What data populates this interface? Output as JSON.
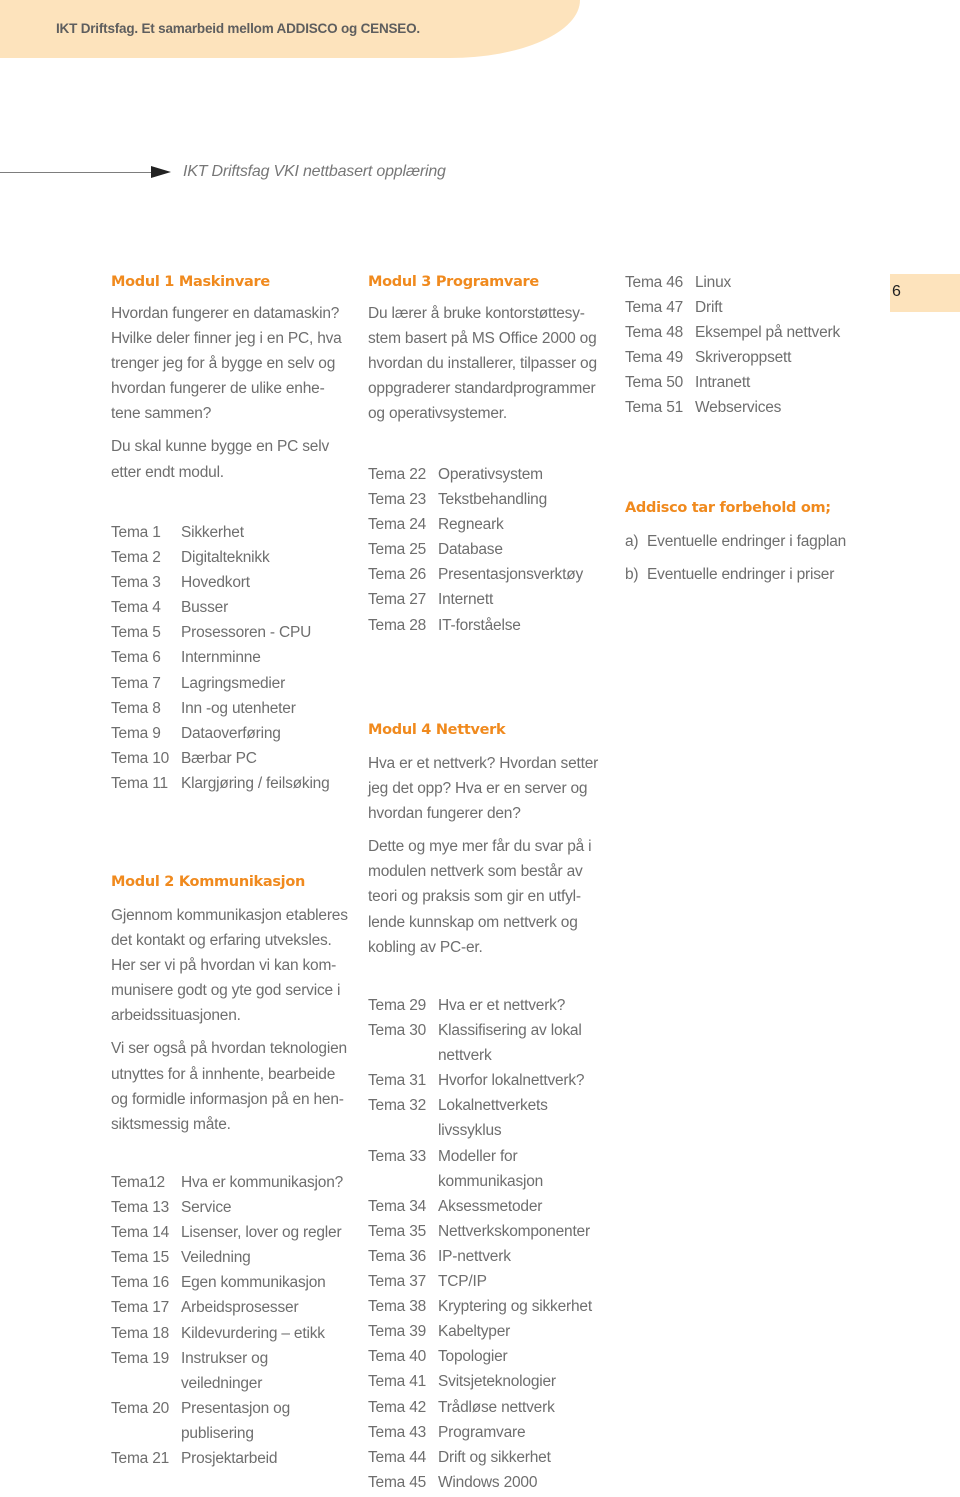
{
  "header": {
    "text": "IKT Driftsfag. Et samarbeid mellom ADDISCO og CENSEO.",
    "band_color": "#fde3bc"
  },
  "subtitle": "IKT Driftsfag VKI nettbasert opplæring",
  "page_number": "6",
  "accent_color": "#f08a1e",
  "modul1": {
    "title": "Modul 1 Maskinvare",
    "paragraphs": [
      "Hvordan fungerer en datamaskin? Hvilke deler finner jeg i en PC, hva trenger jeg for å bygge en selv og hvordan fungerer de ulike enhe-tene sammen?",
      "Du skal kunne bygge en PC selv etter endt modul."
    ],
    "topics": [
      {
        "k": "Tema 1",
        "v": "Sikkerhet"
      },
      {
        "k": "Tema 2",
        "v": "Digitalteknikk"
      },
      {
        "k": "Tema 3",
        "v": "Hovedkort"
      },
      {
        "k": "Tema 4",
        "v": "Busser"
      },
      {
        "k": "Tema 5",
        "v": "Prosessoren - CPU"
      },
      {
        "k": "Tema 6",
        "v": "Internminne"
      },
      {
        "k": "Tema 7",
        "v": "Lagringsmedier"
      },
      {
        "k": "Tema 8",
        "v": "Inn -og utenheter"
      },
      {
        "k": "Tema 9",
        "v": "Dataoverføring"
      },
      {
        "k": "Tema 10",
        "v": "Bærbar PC"
      },
      {
        "k": "Tema 11",
        "v": "Klargjøring / feilsøking"
      }
    ]
  },
  "modul2": {
    "title": "Modul 2 Kommunikasjon",
    "paragraphs": [
      "Gjennom kommunikasjon etableres det kontakt og erfaring utveksles. Her ser vi på hvordan vi kan kom-munisere godt og yte god service i arbeidssituasjonen.",
      "Vi ser også på hvordan teknologien utnyttes for å innhente, bearbeide og formidle informasjon på en hen-siktsmessig måte."
    ],
    "topics": [
      {
        "k": "Tema12",
        "v": "Hva er kommunikasjon?"
      },
      {
        "k": "Tema 13",
        "v": "Service"
      },
      {
        "k": "Tema 14",
        "v": "Lisenser, lover og regler"
      },
      {
        "k": "Tema 15",
        "v": "Veiledning"
      },
      {
        "k": "Tema 16",
        "v": "Egen kommunikasjon"
      },
      {
        "k": "Tema 17",
        "v": "Arbeidsprosesser"
      },
      {
        "k": "Tema 18",
        "v": "Kildevurdering – etikk"
      },
      {
        "k": "Tema 19",
        "v": "Instrukser og veiledninger"
      },
      {
        "k": "Tema 20",
        "v": "Presentasjon og publisering"
      },
      {
        "k": "Tema 21",
        "v": "Prosjektarbeid"
      }
    ]
  },
  "modul3": {
    "title": "Modul 3 Programvare",
    "paragraphs": [
      "Du lærer å bruke kontorstøttesy-stem basert på MS Office 2000 og hvordan du installerer, tilpasser og oppgraderer standardprogrammer og operativsystemer."
    ],
    "topics": [
      {
        "k": "Tema 22",
        "v": "Operativsystem"
      },
      {
        "k": "Tema 23",
        "v": "Tekstbehandling"
      },
      {
        "k": "Tema 24",
        "v": "Regneark"
      },
      {
        "k": "Tema 25",
        "v": "Database"
      },
      {
        "k": "Tema 26",
        "v": "Presentasjonsverktøy"
      },
      {
        "k": "Tema 27",
        "v": "Internett"
      },
      {
        "k": "Tema 28",
        "v": "IT-forståelse"
      }
    ]
  },
  "modul4": {
    "title": "Modul 4 Nettverk",
    "paragraphs": [
      "Hva er et nettverk? Hvordan setter jeg det opp? Hva er en server og hvordan fungerer den?",
      "Dette og mye mer får du svar på i modulen nettverk som består av teori og praksis som gir en utfyl-lende kunnskap om nettverk og kobling av PC-er."
    ],
    "topics": [
      {
        "k": "Tema 29",
        "v": "Hva er et nettverk?"
      },
      {
        "k": "Tema 30",
        "v": "Klassifisering av lokal nettverk"
      },
      {
        "k": "Tema 31",
        "v": "Hvorfor lokalnettverk?"
      },
      {
        "k": "Tema 32",
        "v": "Lokalnettverkets livssyklus"
      },
      {
        "k": "Tema 33",
        "v": "Modeller for kommunikasjon"
      },
      {
        "k": "Tema 34",
        "v": "Aksessmetoder"
      },
      {
        "k": "Tema 35",
        "v": "Nettverkskomponenter"
      },
      {
        "k": "Tema 36",
        "v": "IP-nettverk"
      },
      {
        "k": "Tema 37",
        "v": "TCP/IP"
      },
      {
        "k": "Tema 38",
        "v": "Kryptering og sikkerhet"
      },
      {
        "k": "Tema 39",
        "v": "Kabeltyper"
      },
      {
        "k": "Tema 40",
        "v": "Topologier"
      },
      {
        "k": "Tema 41",
        "v": "Svitsjeteknologier"
      },
      {
        "k": "Tema 42",
        "v": "Trådløse nettverk"
      },
      {
        "k": "Tema 43",
        "v": "Programvare"
      },
      {
        "k": "Tema 44",
        "v": "Drift og sikkerhet"
      },
      {
        "k": "Tema 45",
        "v": "Windows 2000"
      }
    ],
    "topics_cont": [
      {
        "k": "Tema 46",
        "v": "Linux"
      },
      {
        "k": "Tema 47",
        "v": "Drift"
      },
      {
        "k": "Tema 48",
        "v": "Eksempel på nettverk"
      },
      {
        "k": "Tema 49",
        "v": "Skriveroppsett"
      },
      {
        "k": "Tema 50",
        "v": "Intranett"
      },
      {
        "k": "Tema 51",
        "v": "Webservices"
      }
    ]
  },
  "disclaimer": {
    "title": "Addisco tar forbehold om;",
    "items": [
      {
        "k": "a)",
        "v": "Eventuelle endringer i fagplan"
      },
      {
        "k": "b)",
        "v": "Eventuelle endringer i priser"
      }
    ]
  }
}
